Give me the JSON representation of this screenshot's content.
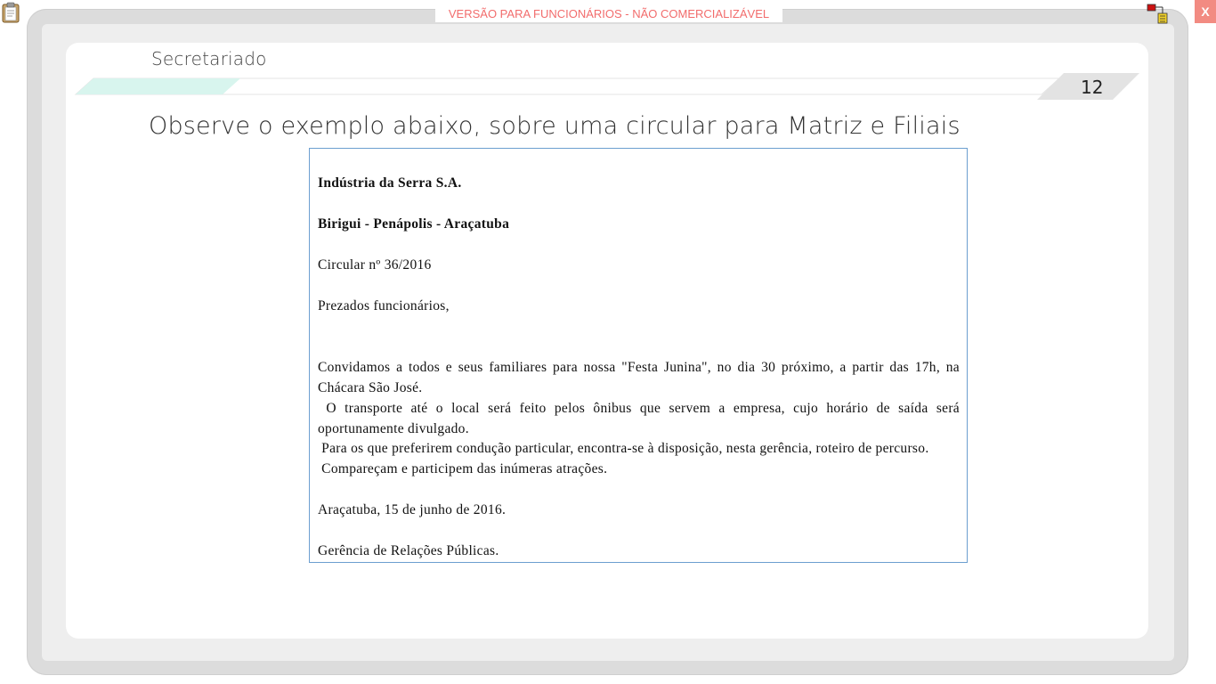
{
  "window": {
    "banner": "VERSÃO PARA FUNCIONÁRIOS - NÃO COMERCIALIZÁVEL",
    "close_label": "X"
  },
  "header": {
    "section": "Secretariado",
    "page_number": "12"
  },
  "main": {
    "heading": "Observe o exemplo abaixo,  sobre uma circular para Matriz e Filiais"
  },
  "document": {
    "company": "Indústria da Serra S.A.",
    "locations": "Birigui - Penápolis - Araçatuba",
    "circular": "Circular nº 36/2016",
    "greeting": "Prezados funcionários,",
    "p1_line1": "Convidamos a todos e seus familiares para nossa \"Festa Junina\", no dia 30 próximo, a partir das 17h, na",
    "p1_line2": "Chácara São José.",
    "p2_line1": " O transporte até o local será feito pelos ônibus que servem a empresa, cujo horário de saída será",
    "p2_line2": "oportunamente divulgado.",
    "p3": " Para os que preferirem condução particular, encontra-se à disposição, nesta gerência, roteiro de percurso.",
    "p4": " Compareçam e participem das inúmeras atrações.",
    "date": "Araçatuba, 15 de junho de 2016.",
    "signature": "Gerência de Relações Públicas."
  },
  "colors": {
    "banner_text": "#f26c6c",
    "close_bg": "#f28b82",
    "accent_stripe": "#d8f5ee",
    "doc_border": "#6c9fd0"
  },
  "icons": [
    "clipboard-icon",
    "network-icon"
  ]
}
